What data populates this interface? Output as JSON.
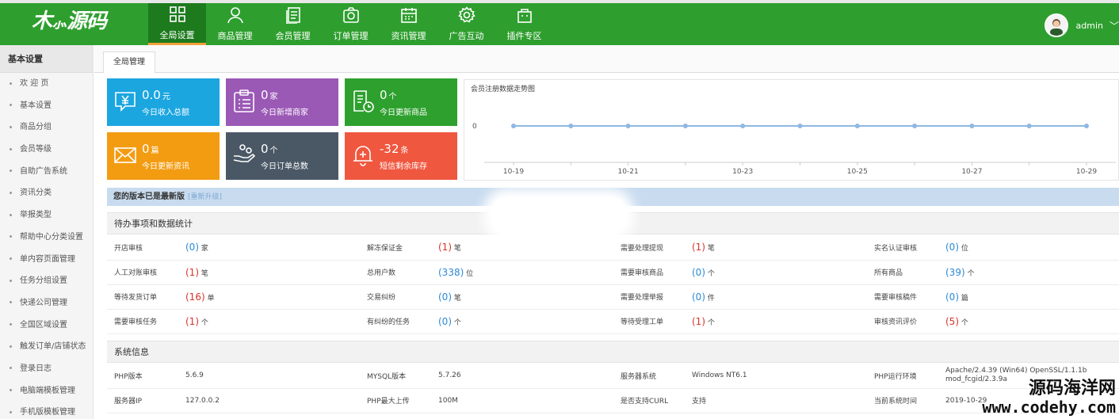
{
  "header": {
    "logo_text": "源码",
    "nav": [
      {
        "label": "全局设置",
        "icon": "grid-icon",
        "active": true
      },
      {
        "label": "商品管理",
        "icon": "user-icon",
        "active": false
      },
      {
        "label": "会员管理",
        "icon": "document-icon",
        "active": false
      },
      {
        "label": "订单管理",
        "icon": "camera-icon",
        "active": false
      },
      {
        "label": "资讯管理",
        "icon": "calendar-icon",
        "active": false
      },
      {
        "label": "广告互动",
        "icon": "gear-icon",
        "active": false
      },
      {
        "label": "插件专区",
        "icon": "bag-icon",
        "active": false
      }
    ],
    "username": "admin"
  },
  "sidebar": {
    "title": "基本设置",
    "items": [
      "欢 迎 页",
      "基本设置",
      "商品分组",
      "会员等级",
      "自助广告系统",
      "资讯分类",
      "举报类型",
      "帮助中心分类设置",
      "单内容页面管理",
      "任务分组设置",
      "快递公司管理",
      "全国区域设置",
      "触发订单/店铺状态",
      "登录日志",
      "电脑端模板管理",
      "手机版模板管理"
    ]
  },
  "main": {
    "tab": "全局管理",
    "cards": [
      {
        "value": "0.0",
        "unit": "元",
        "label": "今日收入总额",
        "color": "#1ba6e0",
        "icon": "yen-icon"
      },
      {
        "value": "0",
        "unit": "家",
        "label": "今日新增商家",
        "color": "#9b59b6",
        "icon": "clipboard-icon"
      },
      {
        "value": "0",
        "unit": "个",
        "label": "今日更新商品",
        "color": "#2ea02e",
        "icon": "doc-clock-icon"
      },
      {
        "value": "0",
        "unit": "篇",
        "label": "今日更新资讯",
        "color": "#f39c12",
        "icon": "mail-icon"
      },
      {
        "value": "0",
        "unit": "个",
        "label": "今日订单总数",
        "color": "#4a5866",
        "icon": "hand-coin-icon"
      },
      {
        "value": "-32",
        "unit": "条",
        "label": "短信剩余库存",
        "color": "#f0573f",
        "icon": "bell-icon"
      }
    ],
    "version": {
      "text": "您的版本已是最新版",
      "upgrade": "[重新升级]"
    },
    "todo": {
      "title": "待办事项和数据统计",
      "rows": [
        [
          {
            "label": "开店审核",
            "value": "(0)",
            "unit": "家",
            "color": "blue"
          },
          {
            "label": "解冻保证金",
            "value": "(1)",
            "unit": "笔",
            "color": "red"
          },
          {
            "label": "需要处理提现",
            "value": "(1)",
            "unit": "笔",
            "color": "red"
          },
          {
            "label": "实名认证审核",
            "value": "(0)",
            "unit": "位",
            "color": "blue"
          }
        ],
        [
          {
            "label": "人工对账审核",
            "value": "(1)",
            "unit": "笔",
            "color": "red"
          },
          {
            "label": "总用户数",
            "value": "(338)",
            "unit": "位",
            "color": "blue"
          },
          {
            "label": "需要审核商品",
            "value": "(0)",
            "unit": "个",
            "color": "blue"
          },
          {
            "label": "所有商品",
            "value": "(39)",
            "unit": "个",
            "color": "blue"
          }
        ],
        [
          {
            "label": "等待发货订单",
            "value": "(16)",
            "unit": "单",
            "color": "red"
          },
          {
            "label": "交易纠纷",
            "value": "(0)",
            "unit": "笔",
            "color": "blue"
          },
          {
            "label": "需要处理举报",
            "value": "(0)",
            "unit": "件",
            "color": "blue"
          },
          {
            "label": "需要审核稿件",
            "value": "(0)",
            "unit": "篇",
            "color": "blue"
          }
        ],
        [
          {
            "label": "需要审核任务",
            "value": "(1)",
            "unit": "个",
            "color": "red"
          },
          {
            "label": "有纠纷的任务",
            "value": "(0)",
            "unit": "个",
            "color": "blue"
          },
          {
            "label": "等待受理工单",
            "value": "(1)",
            "unit": "个",
            "color": "red"
          },
          {
            "label": "审核资讯评价",
            "value": "(5)",
            "unit": "个",
            "color": "red"
          }
        ]
      ]
    },
    "sysinfo": {
      "title": "系统信息",
      "rows": [
        [
          {
            "label": "PHP版本",
            "value": "5.6.9"
          },
          {
            "label": "MYSQL版本",
            "value": "5.7.26"
          },
          {
            "label": "服务器系统",
            "value": "Windows NT6.1"
          },
          {
            "label": "PHP运行环境",
            "value": "Apache/2.4.39 (Win64) OpenSSL/1.1.1b mod_fcgid/2.3.9a"
          }
        ],
        [
          {
            "label": "服务器IP",
            "value": "127.0.0.2"
          },
          {
            "label": "PHP最大上传",
            "value": "100M"
          },
          {
            "label": "是否支持CURL",
            "value": "支持"
          },
          {
            "label": "当前系统时间",
            "value": "2019-10-29"
          }
        ]
      ]
    }
  },
  "chart_data": {
    "type": "line",
    "title": "会员注册数据走势图",
    "x": [
      "10-19",
      "10-20",
      "10-21",
      "10-22",
      "10-23",
      "10-24",
      "10-25",
      "10-26",
      "10-27",
      "10-28",
      "10-29"
    ],
    "x_tick_labels": [
      "10-19",
      "10-21",
      "10-23",
      "10-25",
      "10-27",
      "10-29"
    ],
    "series": [
      {
        "values": [
          0,
          0,
          0,
          0,
          0,
          0,
          0,
          0,
          0,
          0,
          0
        ]
      }
    ],
    "y_tick_labels": [
      "0"
    ],
    "line_color": "#8fb8e3"
  },
  "watermark": {
    "line1": "源码海洋网",
    "line2": "www.codehy.com"
  }
}
